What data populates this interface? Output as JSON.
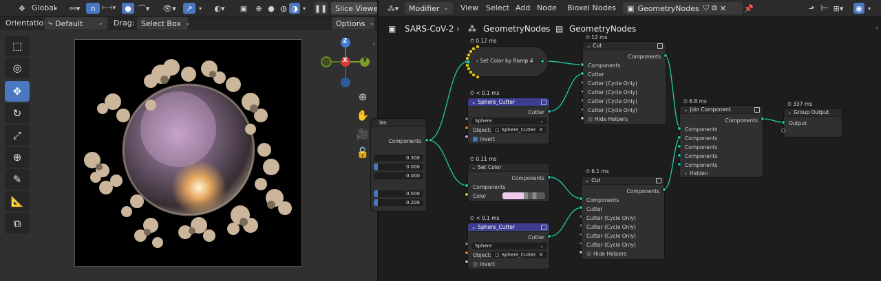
{
  "viewport_header": {
    "orientation_label": "Global",
    "slice_viewer": "Slice Viewe"
  },
  "viewport_subheader": {
    "orientation_label": "Orientation:",
    "orientation_value": "Default",
    "drag_label": "Drag:",
    "drag_value": "Select Box",
    "options_label": "Options"
  },
  "node_header": {
    "editor_type": "Modifier",
    "menus": [
      "View",
      "Select",
      "Add",
      "Node",
      "Bioxel Nodes"
    ],
    "node_tree_name": "GeometryNodes"
  },
  "breadcrumb": {
    "object": "SARS-CoV-2",
    "modifier": "GeometryNodes",
    "node_group": "GeometryNodes"
  },
  "gizmo": {
    "z": "Z",
    "x": "X",
    "y": "Y"
  },
  "partial_node": {
    "title": "ies",
    "output": "Components",
    "values": [
      "0.300",
      "0.000",
      "0.000",
      "0.500",
      "0.200"
    ]
  },
  "node_ramp": {
    "time": "0.12 ms",
    "title": "Set Color by Ramp 4"
  },
  "node_cutter1": {
    "time": "< 0.1 ms",
    "title": "Sphere_Cutter",
    "output": "Cutter",
    "mode": "Sphere",
    "object_label": "Object:",
    "object_value": "Sphere_Cutter",
    "invert_label": "Invert"
  },
  "node_setcolor": {
    "time": "0.11 ms",
    "title": "Set Color",
    "output": "Components",
    "input": "Components",
    "color_label": "Color",
    "color_value": "#f0c8ee"
  },
  "node_cutter2": {
    "time": "< 0.1 ms",
    "title": "Sphere_Cutter",
    "output": "Cutter",
    "mode": "Sphere",
    "object_label": "Object:",
    "object_value": "Sphere_Cutter",
    "invert_label": "Invert"
  },
  "node_cut1": {
    "time": "12 ms",
    "title": "Cut",
    "output": "Components",
    "inputs": [
      "Components",
      "Cutter",
      "Cutter (Cycle Only)",
      "Cutter (Cycle Only)",
      "Cutter (Cycle Only)",
      "Cutter (Cycle Only)"
    ],
    "option": "Hide Helpers"
  },
  "node_cut2": {
    "time": "6.1 ms",
    "title": "Cut",
    "output": "Components",
    "inputs": [
      "Components",
      "Cutter",
      "Cutter (Cycle Only)",
      "Cutter (Cycle Only)",
      "Cutter (Cycle Only)",
      "Cutter (Cycle Only)"
    ],
    "option": "Hide Helpers"
  },
  "node_join": {
    "time": "6.8 ms",
    "title": "Join Component",
    "output": "Components",
    "inputs": [
      "Components",
      "Components",
      "Components",
      "Components",
      "Components"
    ],
    "hidden": "Hidden"
  },
  "node_output": {
    "time": "337 ms",
    "title": "Group Output",
    "input": "Output"
  }
}
